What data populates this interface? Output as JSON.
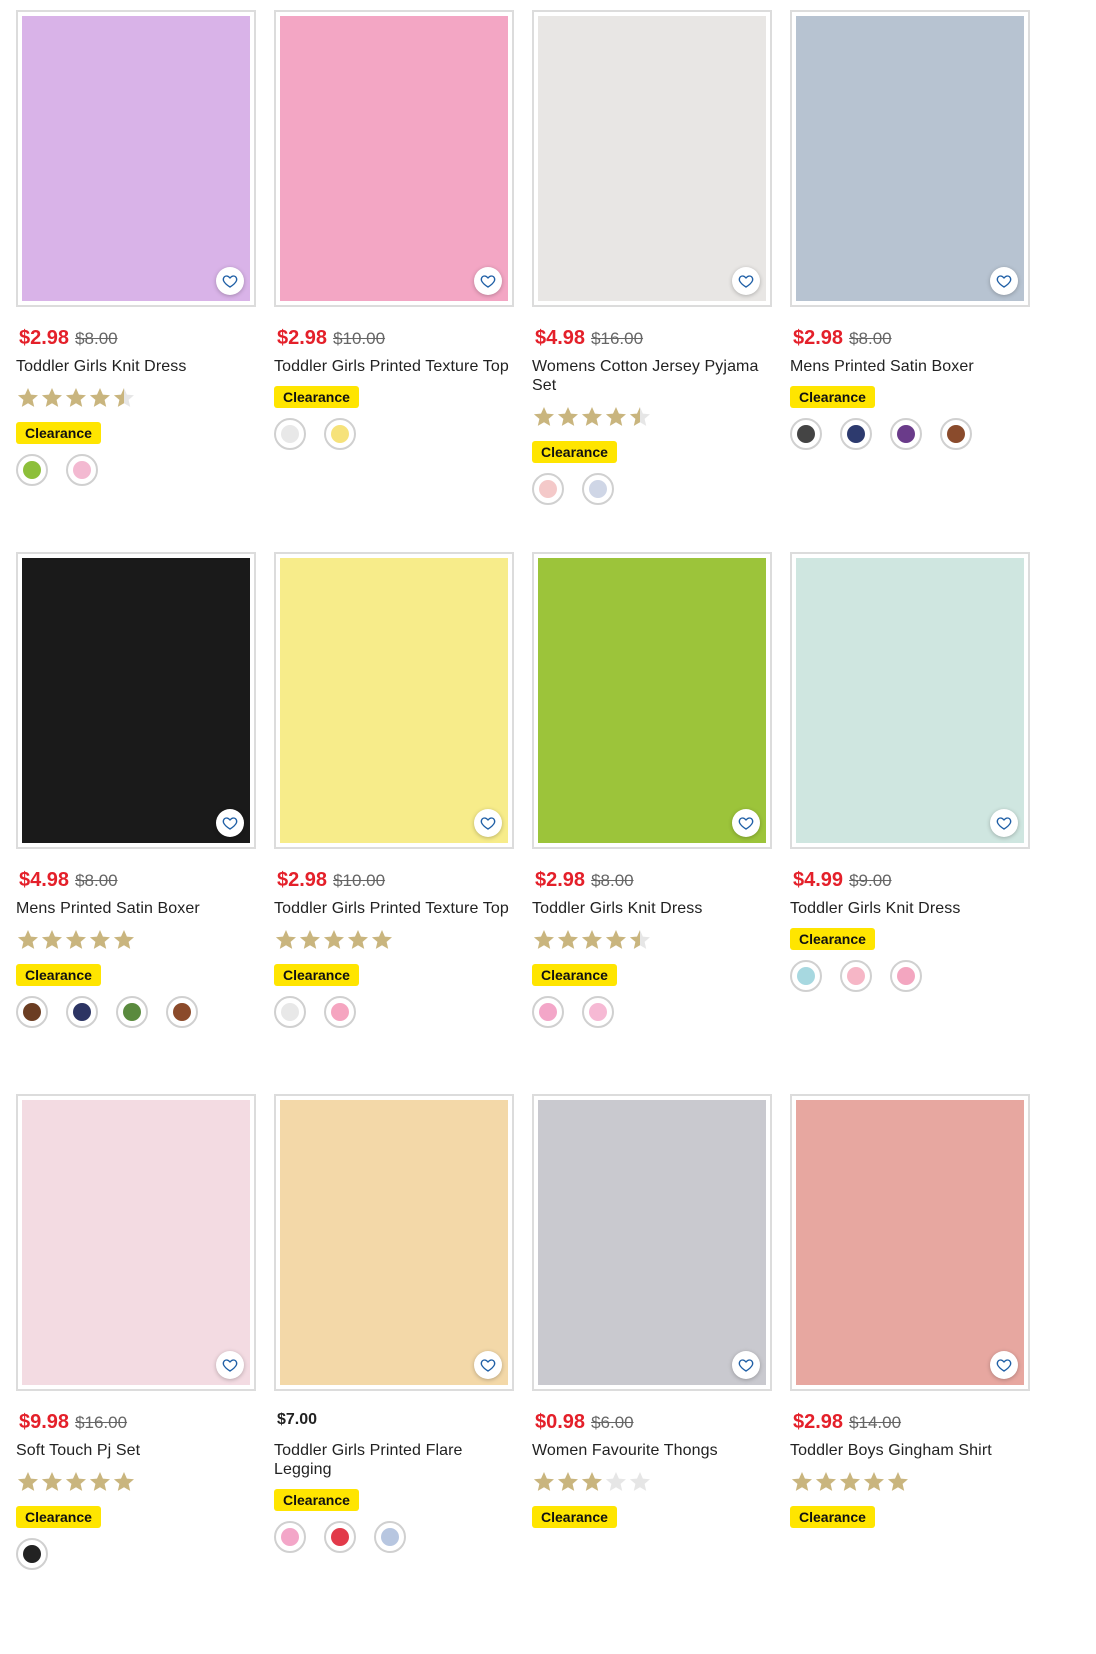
{
  "products": [
    {
      "price": "$2.98",
      "was": "$8.00",
      "title": "Toddler Girls Knit Dress",
      "rating": 4.5,
      "badge": "Clearance",
      "img": "#d9b3e8",
      "swatches": [
        "#8dbf3a",
        "#f3b9d1"
      ]
    },
    {
      "price": "$2.98",
      "was": "$10.00",
      "title": "Toddler Girls Printed Texture Top",
      "rating": null,
      "badge": "Clearance",
      "img": "#f3a6c4",
      "swatches": [
        "#e8e8e8",
        "#f6e27a"
      ]
    },
    {
      "price": "$4.98",
      "was": "$16.00",
      "title": "Womens Cotton Jersey Pyjama Set",
      "rating": 4.5,
      "badge": "Clearance",
      "img": "#e8e6e4",
      "swatches": [
        "#f4c9c9",
        "#cfd6e6"
      ]
    },
    {
      "price": "$2.98",
      "was": "$8.00",
      "title": "Mens Printed Satin Boxer",
      "rating": null,
      "badge": "Clearance",
      "img": "#b7c3d1",
      "swatches": [
        "#444444",
        "#2d3a6e",
        "#6a3b8a",
        "#8a4b2c"
      ]
    },
    {
      "price": "$4.98",
      "was": "$8.00",
      "title": "Mens Printed Satin Boxer",
      "rating": 5,
      "badge": "Clearance",
      "img": "#1a1a1a",
      "swatches": [
        "#6b3d22",
        "#2c3463",
        "#5a8a3e",
        "#8b4a2a"
      ]
    },
    {
      "price": "$2.98",
      "was": "$10.00",
      "title": "Toddler Girls Printed Texture Top",
      "rating": 5,
      "badge": "Clearance",
      "img": "#f7ec8a",
      "swatches": [
        "#e8e8e8",
        "#f5a5c0"
      ]
    },
    {
      "price": "$2.98",
      "was": "$8.00",
      "title": "Toddler Girls Knit Dress",
      "rating": 4.5,
      "badge": "Clearance",
      "img": "#9cc43a",
      "swatches": [
        "#f3a6c8",
        "#f6b9d4"
      ]
    },
    {
      "price": "$4.99",
      "was": "$9.00",
      "title": "Toddler Girls Knit Dress",
      "rating": null,
      "badge": "Clearance",
      "img": "#cfe6e0",
      "swatches": [
        "#a7d8e0",
        "#f6b6c6",
        "#f3a6c0"
      ]
    },
    {
      "price": "$9.98",
      "was": "$16.00",
      "title": "Soft Touch Pj Set",
      "rating": 5,
      "badge": "Clearance",
      "img": "#f3dbe2",
      "swatches": [
        "#222222"
      ]
    },
    {
      "price": "$7.00",
      "was": "",
      "title": "Toddler Girls Printed Flare Legging",
      "rating": null,
      "badge": "Clearance",
      "img": "#f3d8a8",
      "swatches": [
        "#f3a6c8",
        "#e23a4a",
        "#b7c6e0"
      ]
    },
    {
      "price": "$0.98",
      "was": "$6.00",
      "title": "Women Favourite Thongs",
      "rating": 3,
      "badge": "Clearance",
      "img": "#c9c9cf",
      "swatches": []
    },
    {
      "price": "$2.98",
      "was": "$14.00",
      "title": "Toddler Boys Gingham Shirt",
      "rating": 5,
      "badge": "Clearance",
      "img": "#e7a7a0",
      "swatches": []
    }
  ],
  "colors": {
    "price_sale": "#e4202a",
    "badge_bg": "#ffe500",
    "star_filled": "#c9b57e",
    "star_empty": "#e6e6e6",
    "wish_icon": "#1f5fa6"
  },
  "icons": {
    "wishlist": "heart-outline-icon",
    "rating": "star-icon"
  }
}
